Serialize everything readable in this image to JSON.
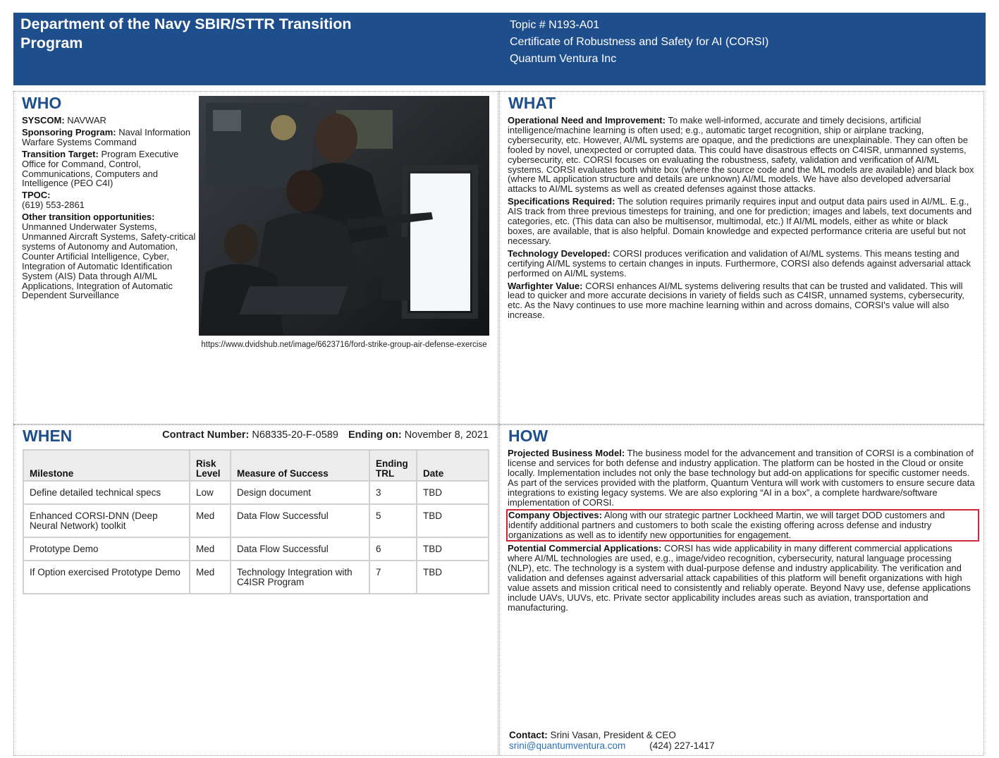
{
  "header": {
    "program_title": "Department of the Navy SBIR/STTR Transition Program",
    "topic": "Topic # N193-A01",
    "project_title": "Certificate of Robustness and Safety for AI (CORSI)",
    "company": "Quantum Ventura Inc"
  },
  "who": {
    "title": "WHO",
    "syscom_label": "SYSCOM:",
    "syscom_value": "NAVWAR",
    "sponsoring_label": "Sponsoring Program:",
    "sponsoring_value": "Naval Information Warfare Systems Command",
    "transition_label": "Transition Target:",
    "transition_value": "Program Executive Office for Command, Control, Communications, Computers and Intelligence (PEO C4I)",
    "tpoc_label": "TPOC:",
    "tpoc_value": "(619) 553-2861",
    "other_label": "Other transition opportunities:",
    "other_value": "Unmanned Underwater Systems, Unmanned Aircraft Systems, Safety-critical systems of Autonomy and Automation, Counter Artificial Intelligence, Cyber, Integration of Automatic Identification System (AIS) Data through AI/ML Applications, Integration of Automatic Dependent Surveillance",
    "photo_caption": "https://www.dvidshub.net/image/6623716/ford-strike-group-air-defense-exercise"
  },
  "what": {
    "title": "WHAT",
    "items": [
      {
        "label": "Operational Need and Improvement:",
        "text": "To make well-informed, accurate and timely decisions, artificial intelligence/machine learning is often used; e.g., automatic target recognition, ship or airplane tracking, cybersecurity, etc. However, AI/ML systems are opaque, and the predictions are unexplainable. They can often be fooled by novel, unexpected or corrupted data. This could have disastrous effects on C4ISR, unmanned systems, cybersecurity, etc. CORSI focuses on evaluating the robustness, safety, validation and verification of AI/ML systems. CORSI evaluates both white box (where the source code and the ML models are available) and black box (where ML application structure and details are unknown) AI/ML models. We have also developed adversarial attacks to AI/ML systems as well as created defenses against those attacks."
      },
      {
        "label": "Specifications Required:",
        "text": "The solution requires primarily requires input and output data pairs used in AI/ML.  E.g., AIS track from three previous timesteps for training, and one for prediction; images and labels, text documents and categories, etc.  (This data can also be multisensor, multimodal, etc.) If AI/ML models, either as white or black boxes, are available, that is also helpful.  Domain knowledge and expected performance criteria are useful but not necessary."
      },
      {
        "label": "Technology Developed:",
        "text": "CORSI produces verification and validation of AI/ML systems.  This means testing and certifying AI/ML systems to certain changes in inputs.  Furthermore, CORSI also defends against adversarial attack performed on AI/ML systems."
      },
      {
        "label": "Warfighter Value:",
        "text": "CORSI enhances AI/ML systems delivering results that can be trusted and validated.  This will lead to quicker and more accurate decisions in variety of fields such as C4ISR, unnamed systems, cybersecurity, etc. As the Navy continues to use more machine learning within and across domains, CORSI's value will also increase."
      }
    ]
  },
  "when": {
    "title": "WHEN",
    "contract_label": "Contract Number:",
    "contract_value": "N68335-20-F-0589",
    "ending_label": "Ending on:",
    "ending_value": "November 8, 2021",
    "columns": [
      "Milestone",
      "Risk Level",
      "Measure of Success",
      "Ending TRL",
      "Date"
    ],
    "rows": [
      [
        "Define detailed technical specs",
        "Low",
        "Design document",
        "3",
        "TBD"
      ],
      [
        "Enhanced CORSI-DNN (Deep Neural Network) toolkit",
        "Med",
        "Data Flow Successful",
        "5",
        "TBD"
      ],
      [
        "Prototype Demo",
        "Med",
        "Data Flow Successful",
        "6",
        "TBD"
      ],
      [
        "If Option exercised Prototype Demo",
        "Med",
        "Technology Integration with C4ISR Program",
        "7",
        "TBD"
      ]
    ]
  },
  "how": {
    "title": "HOW",
    "items": [
      {
        "label": "Projected Business Model:",
        "text": "The business model for the advancement and transition of CORSI is a combination of license and services for both defense and industry application. The platform can be hosted in the Cloud or onsite locally. Implementation includes not only the base technology but add-on applications for specific customer needs. As part of the services provided with the platform, Quantum Ventura will work with customers to ensure secure data integrations to existing legacy systems. We are also exploring “AI in a box”, a complete hardware/software implementation of CORSI."
      },
      {
        "label": "Company Objectives:",
        "text": "Along with our strategic partner Lockheed Martin, we will target DOD customers and identify additional partners and customers to both scale the existing offering across defense and industry organizations as well as to identify new opportunities for engagement."
      },
      {
        "label": "Potential Commercial Applications:",
        "text": "CORSI has wide applicability in many different commercial applications where AI/ML technologies are used, e.g., image/video recognition, cybersecurity, natural language processing (NLP), etc.  The technology is a system with dual-purpose defense and industry applicability. The verification and validation and defenses against adversarial attack capabilities of this platform will benefit organizations with high value assets and mission critical need to consistently and reliably operate. Beyond Navy use, defense applications include UAVs, UUVs, etc. Private sector applicability includes areas such as aviation, transportation and manufacturing."
      }
    ],
    "contact_label": "Contact:",
    "contact_value": "Srini Vasan, President & CEO",
    "email": "srini@quantumventura.com",
    "phone": "(424) 227-1417"
  },
  "colors": {
    "header_bg": "#1f4e8c",
    "section_title": "#1f4e8c",
    "highlight_border": "#d0273a",
    "link": "#2a6fb5"
  }
}
